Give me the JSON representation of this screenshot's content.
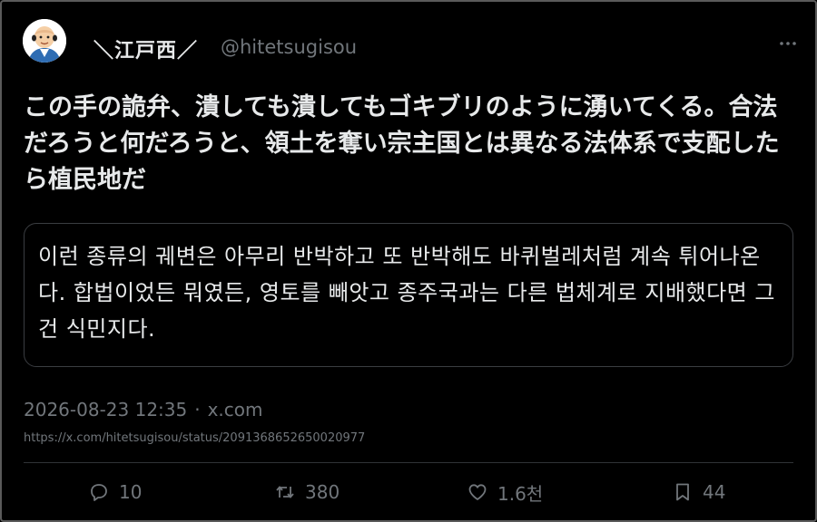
{
  "user": {
    "display_name": "＼江戸西／",
    "handle": "@hitetsugisou"
  },
  "tweet": {
    "text": "この手の詭弁、潰しても潰してもゴキブリのように湧いてくる。合法だろうと何だろうと、領土を奪い宗主国とは異なる法体系で支配したら植民地だ"
  },
  "translation": {
    "text": "이런 종류의 궤변은 아무리 반박하고 또 반박해도 바퀴벌레처럼 계속 튀어나온다. 합법이었든 뭐였든, 영토를 빼앗고 종주국과는 다른 법체계로 지배했다면 그건 식민지다."
  },
  "meta": {
    "timestamp": "2026-08-23 12:35",
    "separator": "·",
    "source": "x.com",
    "url": "https://x.com/hitetsugisou/status/2091368652650020977"
  },
  "actions": {
    "reply_count": "10",
    "repost_count": "380",
    "like_count": "1.6천",
    "bookmark_count": "44"
  },
  "icons": {
    "avatar": "bald-man-avatar-icon",
    "more": "more-dots-icon",
    "reply": "reply-icon",
    "repost": "repost-icon",
    "like": "heart-icon",
    "bookmark": "bookmark-icon"
  },
  "colors": {
    "background": "#000000",
    "text": "#e7e9ea",
    "muted": "#71767b",
    "border": "#2f3336"
  }
}
